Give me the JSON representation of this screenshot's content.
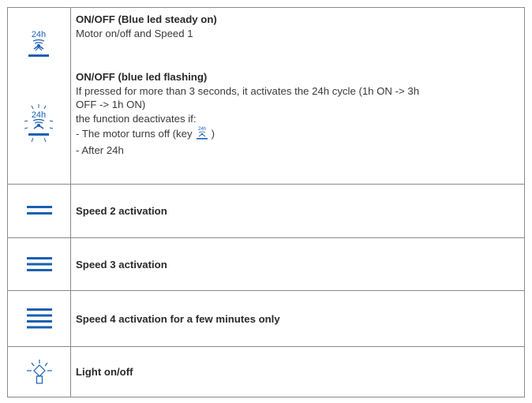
{
  "rows": [
    {
      "icon": "fan-24h-icon",
      "icon_text": "24h",
      "blocks": [
        {
          "title": "ON/OFF (Blue led steady on)",
          "lines": [
            "Motor on/off and Speed 1"
          ]
        },
        {
          "title": "ON/OFF (blue led flashing)",
          "lines": [
            "If pressed for more than 3 seconds, it activates the 24h cycle (1h ON -> 3h",
            "OFF -> 1h ON)",
            "the function deactivates if:",
            "- The motor turns off (key",
            ")",
            "- After 24h"
          ]
        }
      ]
    },
    {
      "icon": "speed-2-icon",
      "label": "Speed 2 activation"
    },
    {
      "icon": "speed-3-icon",
      "label": "Speed 3 activation"
    },
    {
      "icon": "speed-4-icon",
      "label": "Speed 4 activation for a few minutes only"
    },
    {
      "icon": "light-bulb-icon",
      "label": "Light on/off"
    }
  ],
  "colors": {
    "accent": "#1a5fb4",
    "text": "#3a3a3a",
    "border": "#8a8a8a"
  }
}
